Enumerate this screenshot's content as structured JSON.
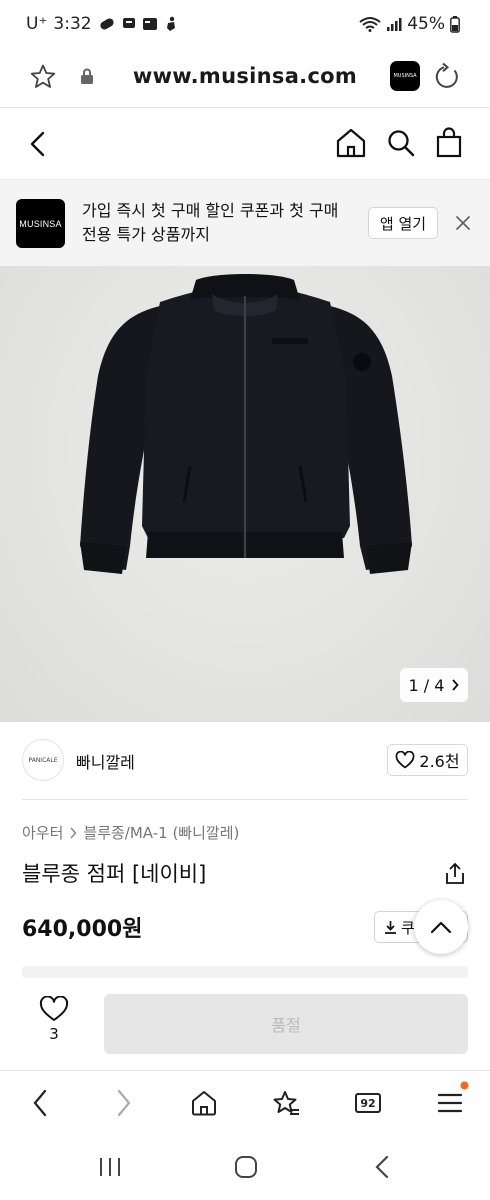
{
  "status_bar": {
    "carrier": "U⁺",
    "time": "3:32",
    "battery": "45%"
  },
  "browser": {
    "url": "www.musinsa.com",
    "site_badge": "MUSINSA",
    "tab_count": "92"
  },
  "banner": {
    "logo_text": "MUSINSA",
    "message": "가입 즉시 첫 구매 할인 쿠폰과 첫 구매 전용 특가 상품까지",
    "open_app_label": "앱 열기"
  },
  "product_image": {
    "counter": "1 / 4"
  },
  "brand": {
    "logo_text": "PANICALE",
    "name": "빠니깔레",
    "likes": "2.6천"
  },
  "product": {
    "breadcrumb": [
      "아우터",
      "블루종/MA-1 (빠니깔레)"
    ],
    "title": "블루종 점퍼 [네이비]",
    "price": "640,000원",
    "coupon_label": "쿠폰"
  },
  "purchase_bar": {
    "wish_count": "3",
    "soldout_label": "품절"
  },
  "colors": {
    "jacket": "#15171d",
    "background": "#e6e6e4",
    "accent_dot": "#f26a21"
  }
}
